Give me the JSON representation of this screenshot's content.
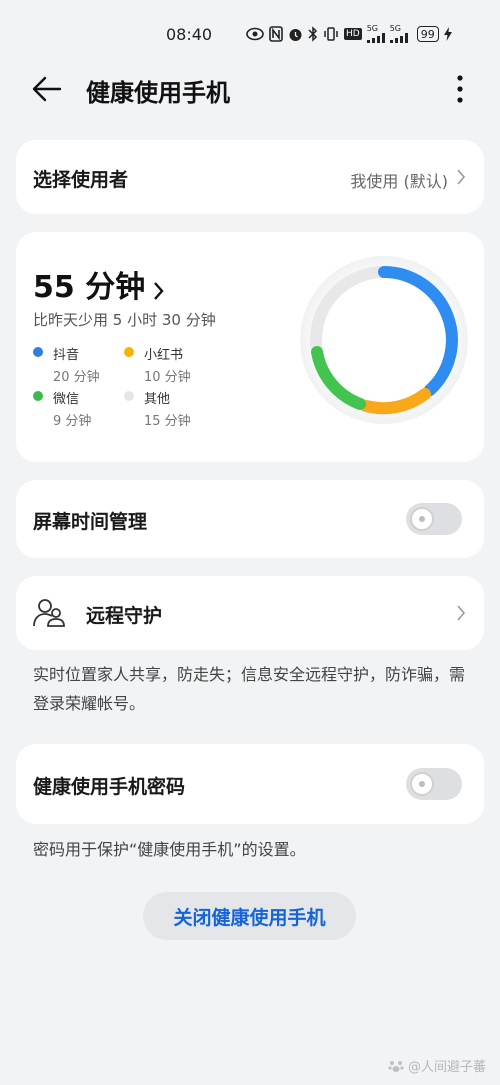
{
  "status_bar": {
    "time": "08:40",
    "network_1": "5G",
    "network_2": "5G",
    "hd_badge": "HD",
    "battery": "99",
    "icons": [
      "eye-icon",
      "nfc-icon",
      "alarm-icon",
      "bluetooth-icon",
      "vibrate-icon",
      "hd-icon",
      "signal-icon",
      "battery-icon",
      "charging-icon"
    ]
  },
  "header": {
    "title": "健康使用手机",
    "back_icon": "arrow-left-icon",
    "more_icon": "more-vertical-icon"
  },
  "user_selector": {
    "label": "选择使用者",
    "value": "我使用 (默认)"
  },
  "usage": {
    "total": "55 分钟",
    "compare": "比昨天少用 5 小时 30 分钟",
    "apps": [
      {
        "name": "抖音",
        "time": "20 分钟",
        "color": "#2f7fe0"
      },
      {
        "name": "小红书",
        "time": "10 分钟",
        "color": "#f7b500"
      },
      {
        "name": "微信",
        "time": "9 分钟",
        "color": "#3cb94f"
      },
      {
        "name": "其他",
        "time": "15 分钟",
        "color": "#e6e6e6"
      }
    ],
    "donut_colors": {
      "blue": "#2f8cf0",
      "orange": "#f9a81a",
      "green": "#43c34f",
      "track": "#e8e8e8"
    }
  },
  "screen_time": {
    "label": "屏幕时间管理",
    "enabled": false
  },
  "remote_guard": {
    "label": "远程守护",
    "description": "实时位置家人共享，防走失；信息安全远程守护，防诈骗，需登录荣耀帐号。"
  },
  "password": {
    "label": "健康使用手机密码",
    "enabled": false,
    "description": "密码用于保护“健康使用手机”的设置。"
  },
  "close_button": {
    "label": "关闭健康使用手机"
  },
  "watermark": {
    "text": "@人间避子蕃"
  }
}
